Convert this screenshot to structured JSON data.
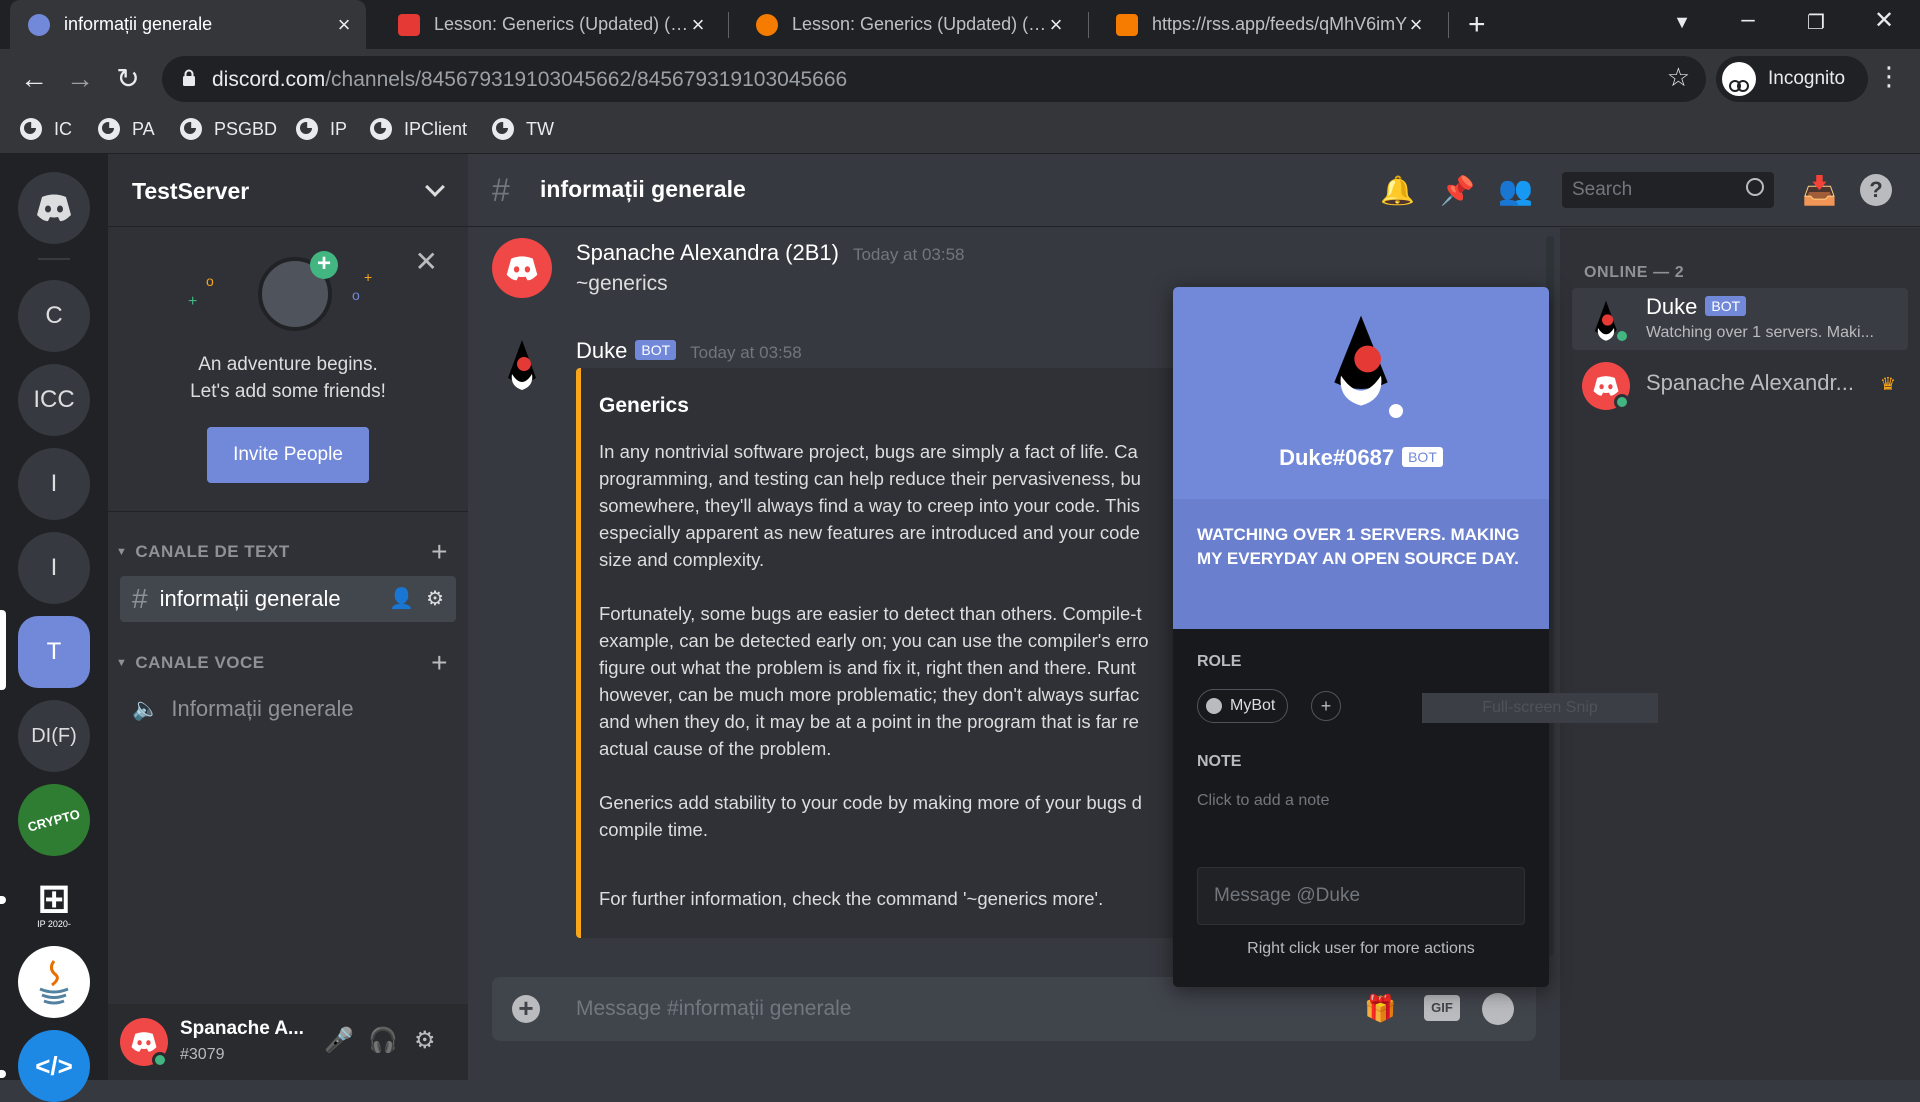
{
  "browser": {
    "tabs": [
      {
        "title": "informații generale",
        "active": true
      },
      {
        "title": "Lesson: Generics (Updated) (The",
        "active": false
      },
      {
        "title": "Lesson: Generics (Updated) (The",
        "active": false
      },
      {
        "title": "https://rss.app/feeds/qMhV6imY",
        "active": false
      }
    ],
    "url_domain": "discord.com",
    "url_path": "/channels/845679319103045662/845679319103045666",
    "profile_label": "Incognito",
    "bookmarks": [
      "IC",
      "PA",
      "PSGBD",
      "IP",
      "IPClient",
      "TW"
    ]
  },
  "guilds": {
    "items": [
      "C",
      "ICC",
      "I",
      "I",
      "T",
      "DI(F)"
    ],
    "badge_count": "1",
    "ip_label": "IP 2020-",
    "crypto_label": "CRYPTO"
  },
  "server": {
    "name": "TestServer",
    "welcome_line1": "An adventure begins.",
    "welcome_line2": "Let's add some friends!",
    "invite_label": "Invite People",
    "categories": [
      {
        "name": "CANALE DE TEXT",
        "channel": "informații generale"
      },
      {
        "name": "CANALE VOCE",
        "channel": "Informații generale"
      }
    ]
  },
  "user": {
    "name": "Spanache A...",
    "tag": "#3079"
  },
  "channel": {
    "title": "informații generale",
    "search_placeholder": "Search",
    "input_placeholder": "Message #informații generale",
    "gif_label": "GIF"
  },
  "messages": [
    {
      "author": "Spanache Alexandra (2B1)",
      "time": "Today at 03:58",
      "text": "~generics"
    },
    {
      "author": "Duke",
      "bot": "BOT",
      "time": "Today at 03:58"
    }
  ],
  "embed": {
    "title": "Generics",
    "paragraphs": [
      "In any nontrivial software project, bugs are simply a fact of life. Ca",
      "programming, and testing can help reduce their pervasiveness, bu",
      "somewhere, they'll always find a way to creep into your code. This",
      "especially apparent as new features are introduced and your code",
      "size and complexity."
    ],
    "paragraphs2": [
      "Fortunately, some bugs are easier to detect than others. Compile-t",
      "example, can be detected early on; you can use the compiler's erro",
      "figure out what the problem is and fix it, right then and there. Runt",
      "however, can be much more problematic; they don't always surfac",
      "and when they do, it may be at a point in the program that is far re",
      "actual cause of the problem."
    ],
    "paragraphs3": [
      "Generics add stability to your code by making more of your bugs d",
      "compile time."
    ],
    "footer": "For further information, check the command '~generics more'."
  },
  "members": {
    "header": "ONLINE — 2",
    "list": [
      {
        "name": "Duke",
        "bot": "BOT",
        "status": "Watching over 1 servers. Maki..."
      },
      {
        "name": "Spanache Alexandr...",
        "status": ""
      }
    ]
  },
  "popout": {
    "name": "Duke#0687",
    "bot": "BOT",
    "activity": "WATCHING OVER 1 SERVERS. MAKING MY EVERYDAY AN OPEN SOURCE DAY.",
    "role_label": "ROLE",
    "role": "MyBot",
    "role_add": "+",
    "note_label": "NOTE",
    "note_placeholder": "Click to add a note",
    "message_placeholder": "Message @Duke",
    "hint": "Right click user for more actions"
  },
  "overlay": {
    "snip_label": "Full-screen Snip"
  },
  "colors": {
    "blurple": "#7289da",
    "embed_bar": "#faa61a",
    "online": "#43b581",
    "red": "#f04747"
  }
}
